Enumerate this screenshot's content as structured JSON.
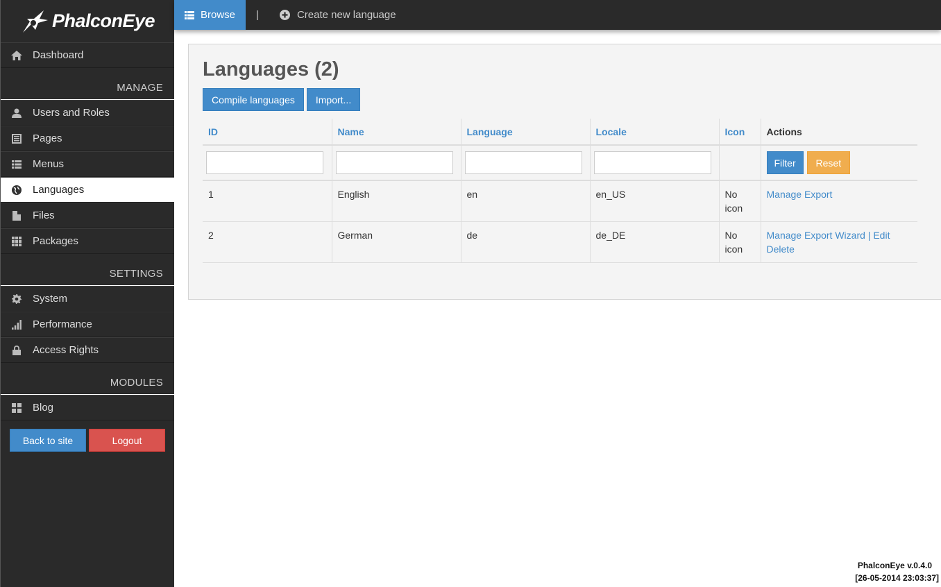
{
  "brand": {
    "name": "PhalconEye"
  },
  "sidebar": {
    "dashboard": "Dashboard",
    "sections": {
      "manage": "MANAGE",
      "settings": "SETTINGS",
      "modules": "MODULES"
    },
    "manage_items": [
      "Users and Roles",
      "Pages",
      "Menus",
      "Languages",
      "Files",
      "Packages"
    ],
    "settings_items": [
      "System",
      "Performance",
      "Access Rights"
    ],
    "modules_items": [
      "Blog"
    ],
    "back_button": "Back to site",
    "logout_button": "Logout"
  },
  "topbar": {
    "browse": "Browse",
    "separator": "|",
    "create": "Create new language"
  },
  "main": {
    "title": "Languages (2)",
    "compile_button": "Compile languages",
    "import_button": "Import...",
    "columns": [
      "ID",
      "Name",
      "Language",
      "Locale",
      "Icon",
      "Actions"
    ],
    "filter_button": "Filter",
    "reset_button": "Reset",
    "rows": [
      {
        "id": "1",
        "name": "English",
        "language": "en",
        "locale": "en_US",
        "icon": "No icon",
        "actions": [
          "Manage",
          "Export"
        ]
      },
      {
        "id": "2",
        "name": "German",
        "language": "de",
        "locale": "de_DE",
        "icon": "No icon",
        "actions": [
          "Manage",
          "Export",
          "Wizard",
          "Edit",
          "Delete"
        ]
      }
    ]
  },
  "footer": {
    "version": "PhalconEye v.0.4.0",
    "timestamp": "[26-05-2014 23:03:37]"
  },
  "colors": {
    "accent": "#428bca",
    "danger": "#d9534f",
    "warning": "#f0ad4e",
    "sidebar_bg": "#2a2a2a"
  }
}
